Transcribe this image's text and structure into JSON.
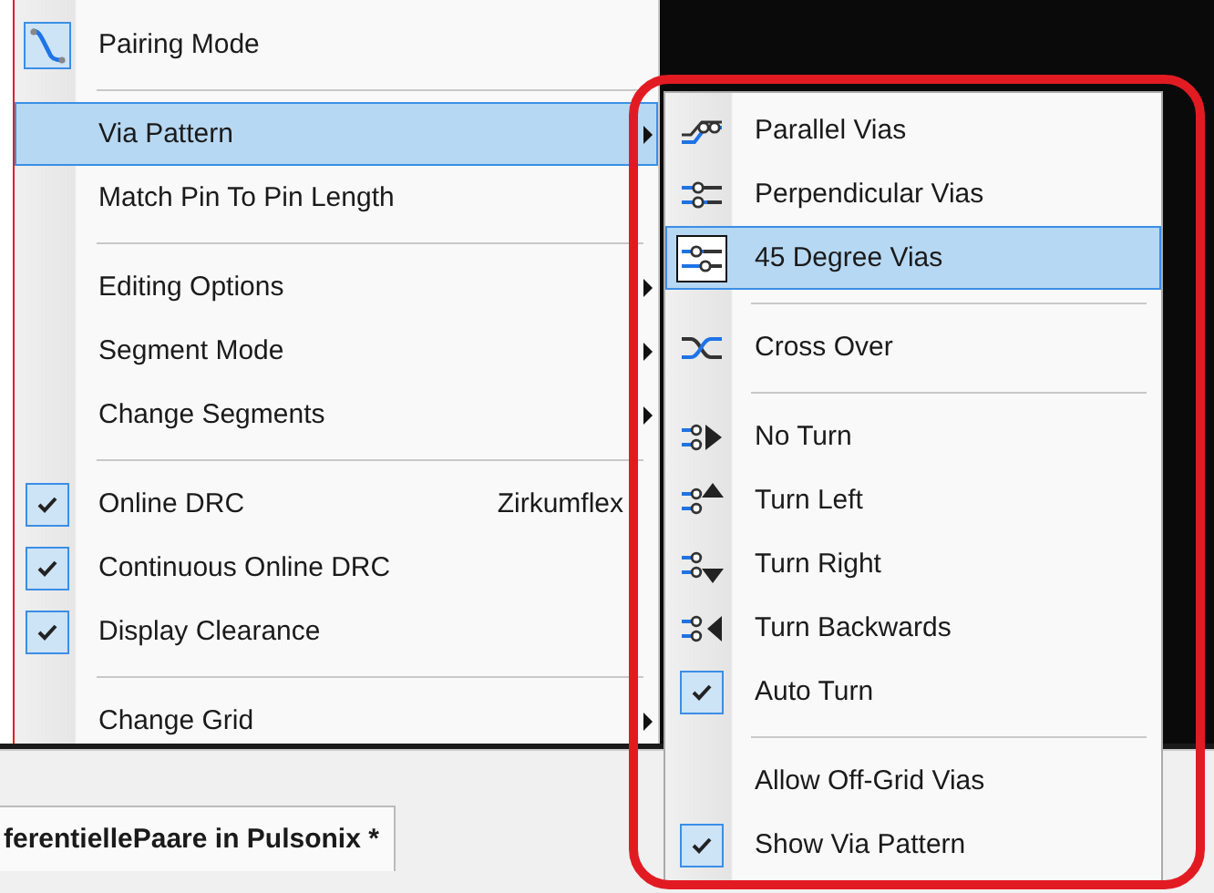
{
  "menu": {
    "items": [
      {
        "kind": "icon",
        "label": "Pairing Mode",
        "checked": true,
        "selected": false,
        "has_submenu": false
      },
      {
        "kind": "separator"
      },
      {
        "kind": "item",
        "label": "Via Pattern",
        "checked": false,
        "selected": true,
        "has_submenu": true
      },
      {
        "kind": "item",
        "label": "Match Pin To Pin Length",
        "checked": false,
        "selected": false,
        "has_submenu": false
      },
      {
        "kind": "separator"
      },
      {
        "kind": "item",
        "label": "Editing Options",
        "checked": false,
        "selected": false,
        "has_submenu": true
      },
      {
        "kind": "item",
        "label": "Segment Mode",
        "checked": false,
        "selected": false,
        "has_submenu": true
      },
      {
        "kind": "item",
        "label": "Change Segments",
        "checked": false,
        "selected": false,
        "has_submenu": true
      },
      {
        "kind": "separator"
      },
      {
        "kind": "item",
        "label": "Online DRC",
        "shortcut": "Zirkumflex",
        "checked": true,
        "selected": false,
        "has_submenu": false
      },
      {
        "kind": "item",
        "label": "Continuous Online DRC",
        "checked": true,
        "selected": false,
        "has_submenu": false
      },
      {
        "kind": "item",
        "label": "Display Clearance",
        "checked": true,
        "selected": false,
        "has_submenu": false
      },
      {
        "kind": "separator"
      },
      {
        "kind": "item",
        "label": "Change Grid",
        "checked": false,
        "selected": false,
        "has_submenu": true
      }
    ]
  },
  "submenu": {
    "items": [
      {
        "kind": "icon",
        "label": "Parallel Vias",
        "selected": false
      },
      {
        "kind": "icon",
        "label": "Perpendicular Vias",
        "selected": false
      },
      {
        "kind": "icon",
        "label": "45 Degree Vias",
        "selected": true
      },
      {
        "kind": "separator"
      },
      {
        "kind": "icon",
        "label": "Cross Over",
        "selected": false
      },
      {
        "kind": "separator"
      },
      {
        "kind": "icon",
        "label": "No Turn",
        "selected": false
      },
      {
        "kind": "icon",
        "label": "Turn Left",
        "selected": false
      },
      {
        "kind": "icon",
        "label": "Turn Right",
        "selected": false
      },
      {
        "kind": "icon",
        "label": "Turn Backwards",
        "selected": false
      },
      {
        "kind": "item",
        "label": "Auto Turn",
        "checked": true,
        "selected": false
      },
      {
        "kind": "separator"
      },
      {
        "kind": "item",
        "label": "Allow Off-Grid Vias",
        "checked": false,
        "selected": false
      },
      {
        "kind": "item",
        "label": "Show Via Pattern",
        "checked": true,
        "selected": false
      }
    ]
  },
  "tabs": [
    {
      "label": "ferentiellePaare in Pulsonix *",
      "selected": true
    }
  ]
}
